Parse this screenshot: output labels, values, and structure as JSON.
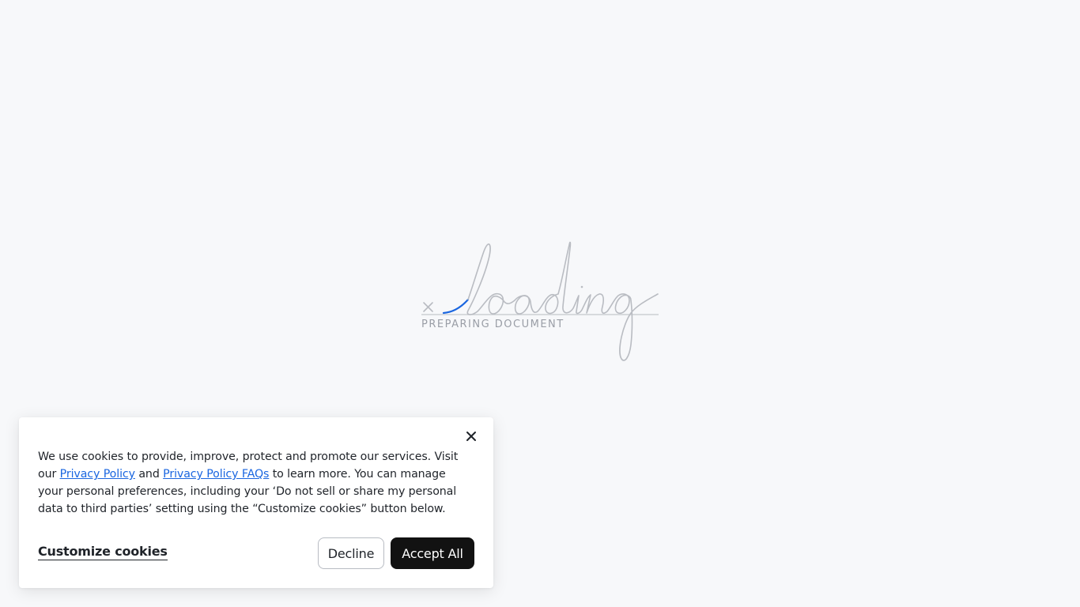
{
  "loader": {
    "signature_word": "loading",
    "caption": "PREPARING DOCUMENT",
    "icons": {
      "sign_mark": "x-mark-icon"
    },
    "colors": {
      "script_stroke": "#b9bcc2",
      "accent_stroke": "#1a66e0",
      "baseline": "#c4c7cc"
    }
  },
  "cookie_banner": {
    "text_before_link1": "We use cookies to provide, improve, protect and promote our services. Visit our ",
    "link1_label": "Privacy Policy",
    "text_between_links": " and ",
    "link2_label": "Privacy Policy FAQs",
    "text_after_links": " to learn more. You can manage your personal preferences, including your ‘Do not sell or share my personal data to third parties’ setting using the “Customize cookies” button below.",
    "customize_label": "Customize cookies",
    "decline_label": "Decline",
    "accept_label": "Accept All",
    "close_icon": "close-icon",
    "colors": {
      "link": "#1a66e0",
      "accept_bg": "#121212",
      "text": "#1f2329"
    }
  }
}
